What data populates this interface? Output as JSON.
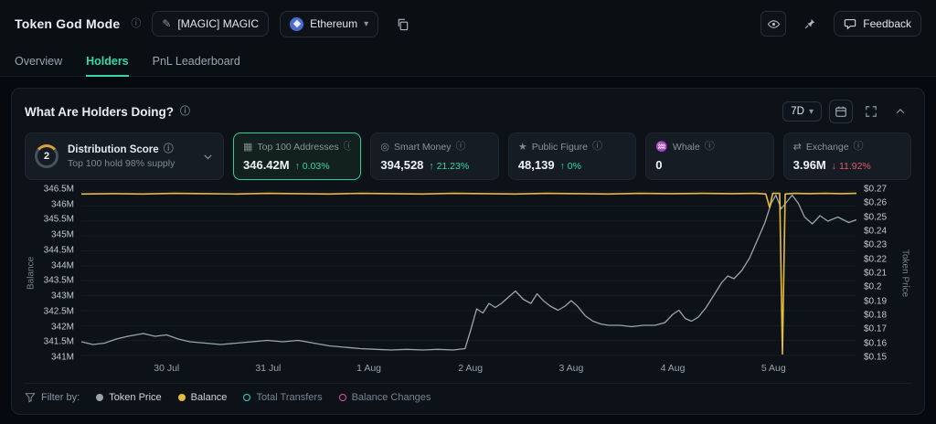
{
  "icons": {
    "info": "ⓘ",
    "caret": "▾",
    "pencil": "✎"
  },
  "header": {
    "title": "Token God Mode",
    "token_button": "[MAGIC] MAGIC",
    "chain_selector": "Ethereum",
    "feedback_label": "Feedback"
  },
  "tabs": [
    {
      "label": "Overview"
    },
    {
      "label": "Holders"
    },
    {
      "label": "PnL Leaderboard"
    }
  ],
  "panel": {
    "title": "What Are Holders Doing?",
    "range": "7D"
  },
  "stats": {
    "distribution": {
      "badge": "2",
      "label": "Distribution Score",
      "subtitle": "Top 100 hold 98% supply"
    },
    "cards": [
      {
        "icon": "▦",
        "label": "Top 100 Addresses",
        "value": "346.42M",
        "arrow": "↑",
        "change": "0.03%",
        "trend": "up"
      },
      {
        "icon": "◎",
        "label": "Smart Money",
        "value": "394,528",
        "arrow": "↑",
        "change": "21.23%",
        "trend": "up"
      },
      {
        "icon": "★",
        "label": "Public Figure",
        "value": "48,139",
        "arrow": "↑",
        "change": "0%",
        "trend": "up"
      },
      {
        "icon": "♒",
        "label": "Whale",
        "value": "0",
        "arrow": "",
        "change": "",
        "trend": "none"
      },
      {
        "icon": "⇄",
        "label": "Exchange",
        "value": "3.96M",
        "arrow": "↓",
        "change": "11.92%",
        "trend": "down"
      }
    ]
  },
  "footer": {
    "filter_label": "Filter by:",
    "legend": [
      {
        "label": "Token Price",
        "color": "#9aa5ae",
        "style": "filled"
      },
      {
        "label": "Balance",
        "color": "#e8bb3d",
        "style": "filled"
      },
      {
        "label": "Total Transfers",
        "color": "#2fd7c3",
        "style": "hollow"
      },
      {
        "label": "Balance Changes",
        "color": "#e052a8",
        "style": "hollow"
      }
    ]
  },
  "colors": {
    "accent_green": "#35d9a3",
    "negative_red": "#e25b66",
    "balance_yellow": "#e8bb3d",
    "price_gray": "#9aa5ae"
  },
  "chart_data": {
    "type": "line",
    "title": "What Are Holders Doing?",
    "x_ticks": [
      {
        "label": "30 Jul",
        "pos": 11.0
      },
      {
        "label": "31 Jul",
        "pos": 24.1
      },
      {
        "label": "1 Aug",
        "pos": 37.1
      },
      {
        "label": "2 Aug",
        "pos": 50.2
      },
      {
        "label": "3 Aug",
        "pos": 63.2
      },
      {
        "label": "4 Aug",
        "pos": 76.3
      },
      {
        "label": "5 Aug",
        "pos": 89.3
      }
    ],
    "left_axis": {
      "label": "Balance",
      "min": 341,
      "max": 346.5,
      "ticks": [
        "346.5M",
        "346M",
        "345.5M",
        "345M",
        "344.5M",
        "344M",
        "343.5M",
        "343M",
        "342.5M",
        "342M",
        "341.5M",
        "341M"
      ]
    },
    "right_axis": {
      "label": "Token Price",
      "min": 0.15,
      "max": 0.27,
      "ticks": [
        "$0.27",
        "$0.26",
        "$0.25",
        "$0.24",
        "$0.23",
        "$0.22",
        "$0.21",
        "$0.2",
        "$0.19",
        "$0.18",
        "$0.17",
        "$0.16",
        "$0.15"
      ]
    },
    "series": [
      {
        "name": "Token Price",
        "axis": "right",
        "color": "#9aa5ae",
        "width": 1.3,
        "points": [
          [
            0,
            0.16
          ],
          [
            1.5,
            0.158
          ],
          [
            3,
            0.159
          ],
          [
            4.5,
            0.162
          ],
          [
            6,
            0.164
          ],
          [
            8,
            0.166
          ],
          [
            9.5,
            0.164
          ],
          [
            11,
            0.165
          ],
          [
            12.5,
            0.162
          ],
          [
            14,
            0.16
          ],
          [
            16,
            0.159
          ],
          [
            18,
            0.158
          ],
          [
            20,
            0.159
          ],
          [
            22,
            0.16
          ],
          [
            24,
            0.161
          ],
          [
            26,
            0.16
          ],
          [
            28,
            0.161
          ],
          [
            30,
            0.159
          ],
          [
            32,
            0.157
          ],
          [
            34,
            0.156
          ],
          [
            36,
            0.155
          ],
          [
            38,
            0.1545
          ],
          [
            40,
            0.154
          ],
          [
            42,
            0.1545
          ],
          [
            44,
            0.154
          ],
          [
            46,
            0.1545
          ],
          [
            48,
            0.154
          ],
          [
            49.5,
            0.155
          ],
          [
            50.2,
            0.168
          ],
          [
            51,
            0.184
          ],
          [
            51.8,
            0.181
          ],
          [
            52.6,
            0.188
          ],
          [
            53.4,
            0.185
          ],
          [
            54.2,
            0.188
          ],
          [
            55,
            0.192
          ],
          [
            56,
            0.197
          ],
          [
            57,
            0.191
          ],
          [
            58,
            0.188
          ],
          [
            58.8,
            0.195
          ],
          [
            59.6,
            0.19
          ],
          [
            60.5,
            0.186
          ],
          [
            61.5,
            0.183
          ],
          [
            62.4,
            0.186
          ],
          [
            63.2,
            0.19
          ],
          [
            64,
            0.186
          ],
          [
            65,
            0.179
          ],
          [
            66,
            0.175
          ],
          [
            67,
            0.173
          ],
          [
            68,
            0.172
          ],
          [
            69.5,
            0.172
          ],
          [
            71,
            0.171
          ],
          [
            72.5,
            0.172
          ],
          [
            74,
            0.172
          ],
          [
            75.3,
            0.174
          ],
          [
            76.3,
            0.18
          ],
          [
            77.1,
            0.183
          ],
          [
            77.9,
            0.177
          ],
          [
            78.7,
            0.175
          ],
          [
            79.6,
            0.178
          ],
          [
            80.6,
            0.185
          ],
          [
            81.6,
            0.194
          ],
          [
            82.6,
            0.203
          ],
          [
            83.4,
            0.208
          ],
          [
            84.2,
            0.206
          ],
          [
            85.2,
            0.212
          ],
          [
            86.2,
            0.221
          ],
          [
            87.2,
            0.234
          ],
          [
            88.2,
            0.247
          ],
          [
            89,
            0.261
          ],
          [
            89.6,
            0.267
          ],
          [
            90.3,
            0.257
          ],
          [
            91,
            0.262
          ],
          [
            91.7,
            0.267
          ],
          [
            92.5,
            0.261
          ],
          [
            93.3,
            0.251
          ],
          [
            94.3,
            0.246
          ],
          [
            95.3,
            0.252
          ],
          [
            96.3,
            0.248
          ],
          [
            97.6,
            0.251
          ],
          [
            99,
            0.247
          ],
          [
            100,
            0.249
          ]
        ]
      },
      {
        "name": "Balance",
        "axis": "left",
        "color": "#e8bb3d",
        "width": 1.6,
        "points": [
          [
            0,
            346.4
          ],
          [
            4,
            346.41
          ],
          [
            8,
            346.4
          ],
          [
            12,
            346.42
          ],
          [
            16,
            346.41
          ],
          [
            20,
            346.4
          ],
          [
            24,
            346.42
          ],
          [
            28,
            346.41
          ],
          [
            32,
            346.4
          ],
          [
            36,
            346.42
          ],
          [
            40,
            346.41
          ],
          [
            44,
            346.4
          ],
          [
            48,
            346.42
          ],
          [
            52,
            346.41
          ],
          [
            56,
            346.4
          ],
          [
            60,
            346.42
          ],
          [
            64,
            346.41
          ],
          [
            68,
            346.4
          ],
          [
            72,
            346.42
          ],
          [
            76,
            346.41
          ],
          [
            80,
            346.42
          ],
          [
            84,
            346.41
          ],
          [
            87,
            346.42
          ],
          [
            88.3,
            346.4
          ],
          [
            88.8,
            345.95
          ],
          [
            89.2,
            346.42
          ],
          [
            90.1,
            346.42
          ],
          [
            90.45,
            341.05
          ],
          [
            90.8,
            346.4
          ],
          [
            92,
            346.42
          ],
          [
            94,
            346.41
          ],
          [
            96,
            346.42
          ],
          [
            98,
            346.41
          ],
          [
            100,
            346.42
          ]
        ]
      }
    ]
  }
}
